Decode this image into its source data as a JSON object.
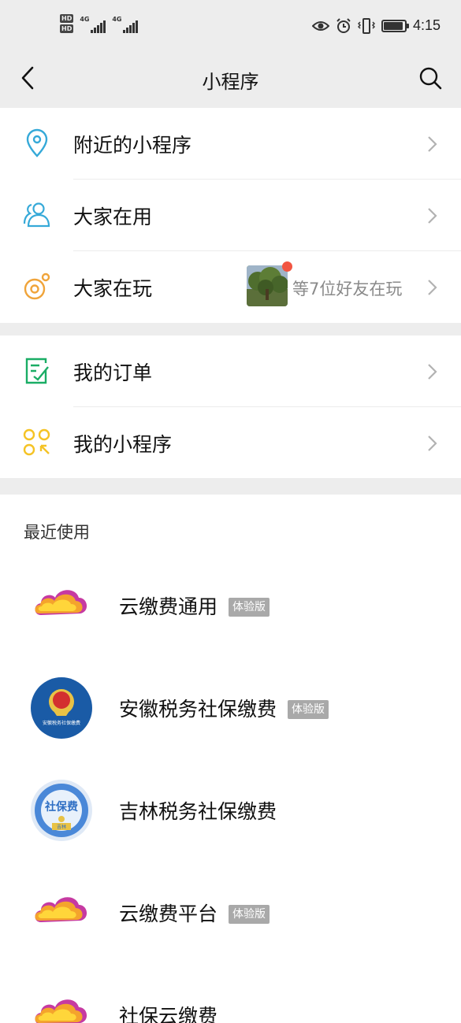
{
  "status_bar": {
    "network_labels": [
      "HD",
      "HD",
      "4G",
      "4G"
    ],
    "time": "4:15",
    "battery_level": 0.85
  },
  "nav": {
    "title": "小程序"
  },
  "menu_group_1": [
    {
      "label": "附近的小程序",
      "icon": "location-pin-icon"
    },
    {
      "label": "大家在用",
      "icon": "people-icon"
    },
    {
      "label": "大家在玩",
      "icon": "game-icon"
    }
  ],
  "friends_playing": "等7位好友在玩",
  "menu_group_2": [
    {
      "label": "我的订单",
      "icon": "order-icon"
    },
    {
      "label": "我的小程序",
      "icon": "mini-programs-grid-icon"
    }
  ],
  "recent": {
    "title": "最近使用",
    "apps": [
      {
        "name": "云缴费通用",
        "badge": "体验版",
        "logo": "cloud-pay-logo"
      },
      {
        "name": "安徽税务社保缴费",
        "badge": "体验版",
        "logo": "anhui-tax-logo",
        "logo_text": "安徽税务社保缴费"
      },
      {
        "name": "吉林税务社保缴费",
        "badge": "",
        "logo": "jilin-tax-logo",
        "logo_text": "社保费",
        "logo_subtext": "吉林"
      },
      {
        "name": "云缴费平台",
        "badge": "体验版",
        "logo": "cloud-pay-logo"
      },
      {
        "name": "社保云缴费",
        "badge": "",
        "logo": "cloud-pay-logo"
      }
    ]
  },
  "colors": {
    "background": "#ededed",
    "icon_blue": "#35a9d8",
    "icon_orange": "#f0a43a",
    "icon_green": "#1aad65",
    "icon_yellow": "#f5c325",
    "badge_gray": "#a9a9a9",
    "red_dot": "#f25542"
  }
}
